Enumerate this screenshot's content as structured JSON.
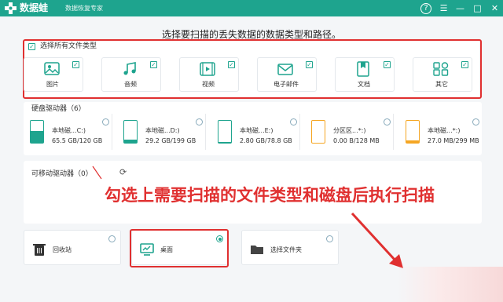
{
  "app": {
    "name": "数据蛙",
    "subtitle": "数据恢复专家",
    "controls": {
      "help": "?",
      "menu": "☰",
      "minimize": "—",
      "maximize": "□",
      "close": "✕"
    }
  },
  "heading": "选择要扫描的丢失数据的数据类型和路径。",
  "file_types": {
    "select_all_label": "选择所有文件类型",
    "select_all_checked": true,
    "items": [
      {
        "label": "图片",
        "icon": "image-icon",
        "checked": true
      },
      {
        "label": "音频",
        "icon": "music-icon",
        "checked": true
      },
      {
        "label": "视频",
        "icon": "video-icon",
        "checked": true
      },
      {
        "label": "电子邮件",
        "icon": "email-icon",
        "checked": true
      },
      {
        "label": "文档",
        "icon": "document-icon",
        "checked": true
      },
      {
        "label": "其它",
        "icon": "other-icon",
        "checked": true
      }
    ]
  },
  "drives": {
    "title": "硬盘驱动器（6）",
    "items": [
      {
        "name": "本地磁...C:)",
        "size": "65.5 GB/120 GB",
        "fill": 0.55,
        "color": "#1ea48e"
      },
      {
        "name": "本地磁...D:)",
        "size": "29.2 GB/199 GB",
        "fill": 0.15,
        "color": "#1ea48e"
      },
      {
        "name": "本地磁...E:)",
        "size": "2.80 GB/78.8 GB",
        "fill": 0.04,
        "color": "#1ea48e"
      },
      {
        "name": "分区区...*:)",
        "size": "0.00  B/128 MB",
        "fill": 0.0,
        "color": "#f5a623"
      },
      {
        "name": "本地磁...*:)",
        "size": "27.0 MB/299 MB",
        "fill": 0.09,
        "color": "#f5a623"
      }
    ]
  },
  "removable": {
    "title": "可移动驱动器（0）"
  },
  "annotation": "勾选上需要扫描的文件类型和磁盘后执行扫描",
  "locations": [
    {
      "label": "回收站",
      "icon": "trash-icon",
      "selected": false
    },
    {
      "label": "桌面",
      "icon": "desktop-icon",
      "selected": true
    },
    {
      "label": "选择文件夹",
      "icon": "folder-icon",
      "selected": false
    }
  ],
  "colors": {
    "brand": "#1ea48e",
    "highlight": "#e03030",
    "warning": "#f5a623"
  }
}
